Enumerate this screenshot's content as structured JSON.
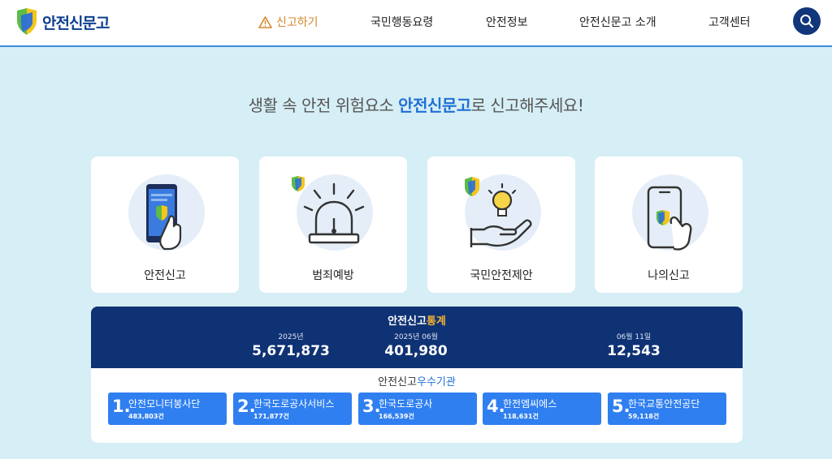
{
  "header": {
    "logo_text": "안전신문고",
    "nav": [
      {
        "label": "신고하기",
        "active": true
      },
      {
        "label": "국민행동요령",
        "active": false
      },
      {
        "label": "안전정보",
        "active": false
      },
      {
        "label": "안전신문고 소개",
        "active": false
      },
      {
        "label": "고객센터",
        "active": false
      }
    ]
  },
  "headline": {
    "prefix": "생활 속 안전 위험요소 ",
    "brand": "안전신문고",
    "suffix": "로 신고해주세요!"
  },
  "cards": [
    {
      "label": "안전신고",
      "icon": "phone-report-icon"
    },
    {
      "label": "범죄예방",
      "icon": "siren-icon"
    },
    {
      "label": "국민안전제안",
      "icon": "idea-hand-icon"
    },
    {
      "label": "나의신고",
      "icon": "my-report-phone-icon"
    }
  ],
  "stats": {
    "title_main": "안전신고",
    "title_hl": "통계",
    "items": [
      {
        "label": "2025년",
        "value": "5,671,873"
      },
      {
        "label": "2025년 06월",
        "value": "401,980"
      },
      {
        "label": "06월 11일",
        "value": "12,543"
      }
    ]
  },
  "orgs": {
    "title_main": "안전신고",
    "title_hl": "우수기관",
    "items": [
      {
        "rank": "1.",
        "name": "안전모니터봉사단",
        "count": "483,803건"
      },
      {
        "rank": "2.",
        "name": "한국도로공사서비스",
        "count": "171,877건"
      },
      {
        "rank": "3.",
        "name": "한국도로공사",
        "count": "166,539건"
      },
      {
        "rank": "4.",
        "name": "한전엠씨에스",
        "count": "118,631건"
      },
      {
        "rank": "5.",
        "name": "한국교통안전공단",
        "count": "59,118건"
      }
    ]
  },
  "colors": {
    "background": "#d6eef5",
    "navy": "#0f3274",
    "accent_orange": "#d4882a",
    "brand_blue": "#1f6fd6",
    "org_button": "#2f7ff0"
  }
}
